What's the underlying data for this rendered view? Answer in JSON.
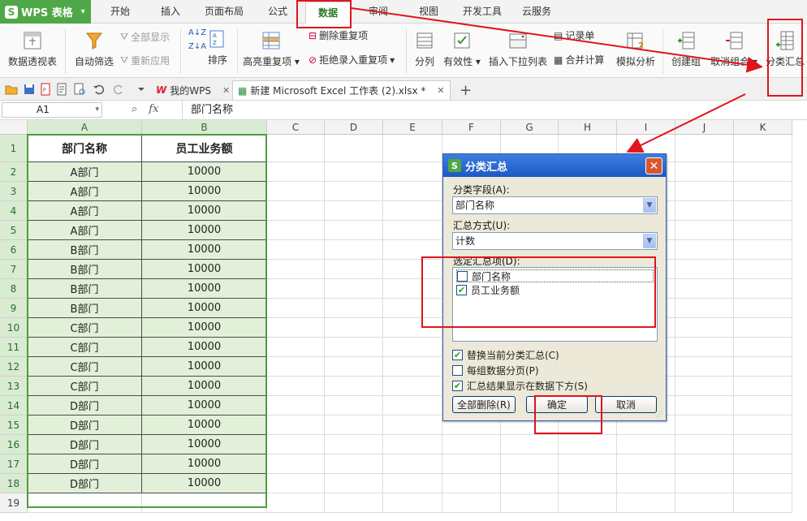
{
  "app": {
    "name": "WPS 表格",
    "logo_text": "S"
  },
  "menu": {
    "tabs": [
      "开始",
      "插入",
      "页面布局",
      "公式",
      "数据",
      "审阅",
      "视图",
      "开发工具",
      "云服务"
    ],
    "active": "数据"
  },
  "ribbon": {
    "pivot": "数据透视表",
    "autofilter": "自动筛选",
    "show_all": "全部显示",
    "reapply": "重新应用",
    "sort": "排序",
    "highlight_dup": "高亮重复项",
    "remove_dup": "删除重复项",
    "reject_dup": "拒绝录入重复项",
    "split": "分列",
    "validity": "有效性",
    "insert_dropdown": "插入下拉列表",
    "record_form": "记录单",
    "merge_calc": "合并计算",
    "simulate": "模拟分析",
    "create_group": "创建组",
    "ungroup": "取消组合",
    "subtotal": "分类汇总"
  },
  "quickbar": {
    "tab_mywps": "我的WPS",
    "tab_file": "新建 Microsoft Excel 工作表 (2).xlsx *",
    "add_tab": "+"
  },
  "formula_bar": {
    "cell_ref": "A1",
    "fx_label": "fx",
    "content": "部门名称"
  },
  "sheet": {
    "columns": [
      "A",
      "B",
      "C",
      "D",
      "E",
      "F",
      "G",
      "H",
      "I",
      "J",
      "K"
    ],
    "row_numbers": [
      "1",
      "2",
      "3",
      "4",
      "5",
      "6",
      "7",
      "8",
      "9",
      "10",
      "11",
      "12",
      "13",
      "14",
      "15",
      "16",
      "17",
      "18",
      "19"
    ],
    "headers": [
      "部门名称",
      "员工业务额"
    ],
    "rows": [
      [
        "A部门",
        "10000"
      ],
      [
        "A部门",
        "10000"
      ],
      [
        "A部门",
        "10000"
      ],
      [
        "A部门",
        "10000"
      ],
      [
        "B部门",
        "10000"
      ],
      [
        "B部门",
        "10000"
      ],
      [
        "B部门",
        "10000"
      ],
      [
        "B部门",
        "10000"
      ],
      [
        "C部门",
        "10000"
      ],
      [
        "C部门",
        "10000"
      ],
      [
        "C部门",
        "10000"
      ],
      [
        "C部门",
        "10000"
      ],
      [
        "D部门",
        "10000"
      ],
      [
        "D部门",
        "10000"
      ],
      [
        "D部门",
        "10000"
      ],
      [
        "D部门",
        "10000"
      ],
      [
        "D部门",
        "10000"
      ]
    ]
  },
  "dialog": {
    "title": "分类汇总",
    "field_label": "分类字段(A):",
    "field_value": "部门名称",
    "method_label": "汇总方式(U):",
    "method_value": "计数",
    "items_label": "选定汇总项(D):",
    "items": [
      {
        "label": "部门名称",
        "checked": false
      },
      {
        "label": "员工业务额",
        "checked": true
      }
    ],
    "opt_replace": "替换当前分类汇总(C)",
    "opt_pagebreak": "每组数据分页(P)",
    "opt_below": "汇总结果显示在数据下方(S)",
    "opt_replace_checked": true,
    "opt_pagebreak_checked": false,
    "opt_below_checked": true,
    "btn_remove_all": "全部删除(R)",
    "btn_ok": "确定",
    "btn_cancel": "取消"
  },
  "colors": {
    "app_green": "#4ea847",
    "selection_fill": "#e2f0d9",
    "selection_border": "#4f9b3f",
    "annotation_red": "#e0141c",
    "dialog_title": "#1c58c4"
  }
}
